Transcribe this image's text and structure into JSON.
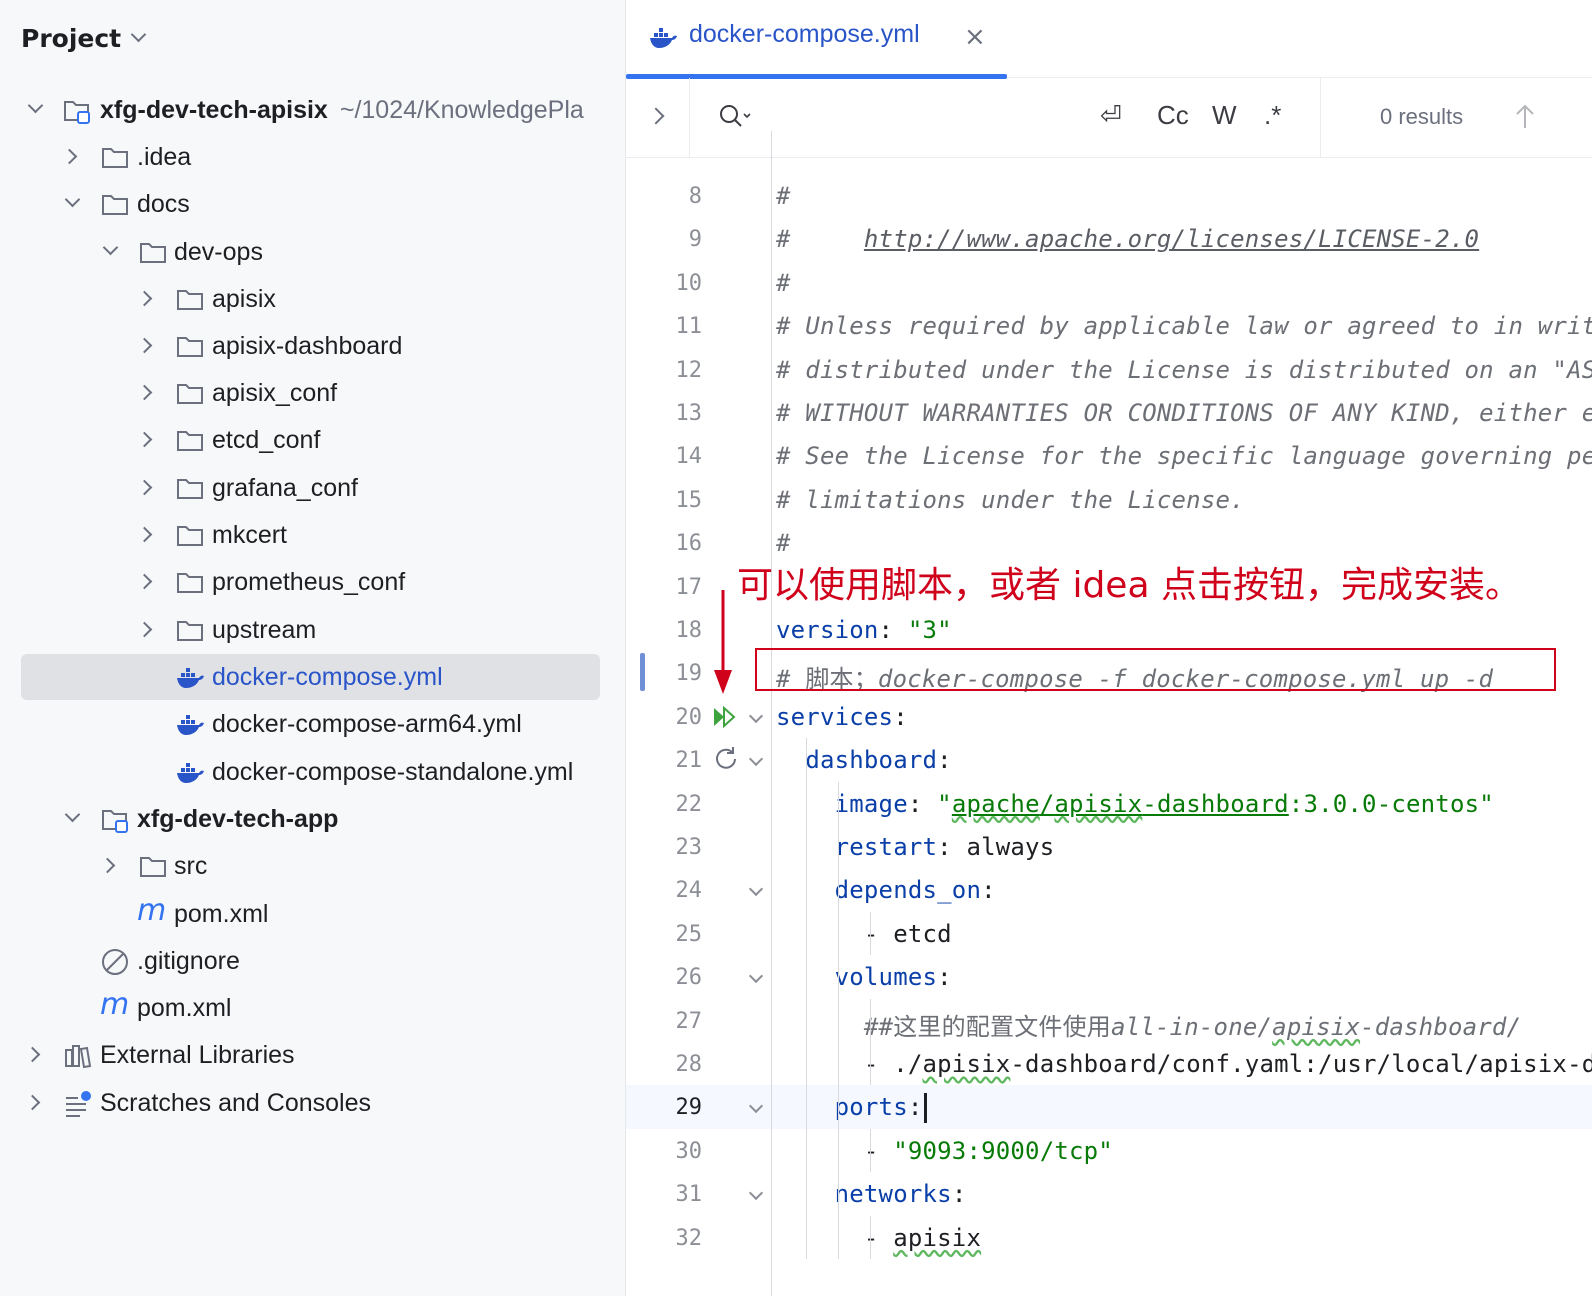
{
  "project_panel": {
    "title": "Project",
    "tree": [
      {
        "label": "xfg-dev-tech-apisix",
        "extra": "~/1024/KnowledgePla",
        "type": "module",
        "bold": true
      },
      {
        "label": ".idea",
        "type": "folder"
      },
      {
        "label": "docs",
        "type": "folder"
      },
      {
        "label": "dev-ops",
        "type": "folder"
      },
      {
        "label": "apisix",
        "type": "folder"
      },
      {
        "label": "apisix-dashboard",
        "type": "folder"
      },
      {
        "label": "apisix_conf",
        "type": "folder"
      },
      {
        "label": "etcd_conf",
        "type": "folder"
      },
      {
        "label": "grafana_conf",
        "type": "folder"
      },
      {
        "label": "mkcert",
        "type": "folder"
      },
      {
        "label": "prometheus_conf",
        "type": "folder"
      },
      {
        "label": "upstream",
        "type": "folder"
      },
      {
        "label": "docker-compose.yml",
        "type": "docker",
        "selected": true
      },
      {
        "label": "docker-compose-arm64.yml",
        "type": "docker"
      },
      {
        "label": "docker-compose-standalone.yml",
        "type": "docker"
      },
      {
        "label": "xfg-dev-tech-app",
        "type": "module",
        "bold": true
      },
      {
        "label": "src",
        "type": "folder"
      },
      {
        "label": "pom.xml",
        "type": "maven"
      },
      {
        "label": ".gitignore",
        "type": "ignore"
      },
      {
        "label": "pom.xml",
        "type": "maven"
      },
      {
        "label": "External Libraries",
        "type": "library"
      },
      {
        "label": "Scratches and Consoles",
        "type": "scratch"
      }
    ]
  },
  "editor": {
    "tab": {
      "label": "docker-compose.yml",
      "close": "×"
    },
    "find": {
      "opt_regex_wrap": "⏎",
      "opt_case": "Cc",
      "opt_word": "W",
      "opt_regex": ".*",
      "results": "0 results"
    },
    "current_line": 29,
    "lines": [
      {
        "n": "8",
        "text": "#"
      },
      {
        "n": "9",
        "text": "#     http://www.apache.org/licenses/LICENSE-2.0"
      },
      {
        "n": "10",
        "text": "#"
      },
      {
        "n": "11",
        "text": "# Unless required by applicable law or agreed to in writing, software"
      },
      {
        "n": "12",
        "text": "# distributed under the License is distributed on an \"AS IS\" BASIS,"
      },
      {
        "n": "13",
        "text": "# WITHOUT WARRANTIES OR CONDITIONS OF ANY KIND, either express or implied."
      },
      {
        "n": "14",
        "text": "# See the License for the specific language governing permissions and"
      },
      {
        "n": "15",
        "text": "# limitations under the License."
      },
      {
        "n": "16",
        "text": "#"
      },
      {
        "n": "17",
        "text": ""
      },
      {
        "n": "18",
        "text": "version: \"3\""
      },
      {
        "n": "19",
        "text": "# 脚本；docker-compose -f docker-compose.yml up -d"
      },
      {
        "n": "20",
        "text": "services:"
      },
      {
        "n": "21",
        "text": "  dashboard:"
      },
      {
        "n": "22",
        "text": "    image: \"apache/apisix-dashboard:3.0.0-centos\""
      },
      {
        "n": "23",
        "text": "    restart: always"
      },
      {
        "n": "24",
        "text": "    depends_on:"
      },
      {
        "n": "25",
        "text": "      - etcd"
      },
      {
        "n": "26",
        "text": "    volumes:"
      },
      {
        "n": "27",
        "text": "      ##这里的配置文件使用all-in-one/apisix-dashboard/"
      },
      {
        "n": "28",
        "text": "      - ./apisix-dashboard/conf.yaml:/usr/local/apisix-dashboard/conf/conf.yaml"
      },
      {
        "n": "29",
        "text": "    ports:"
      },
      {
        "n": "30",
        "text": "      - \"9093:9000/tcp\""
      },
      {
        "n": "31",
        "text": "    networks:"
      },
      {
        "n": "32",
        "text": "      - apisix"
      }
    ]
  },
  "annotation": {
    "text": "可以使用脚本，或者 idea 点击按钮，完成安装。",
    "color": "#d0021b"
  },
  "colors": {
    "accent": "#3574f0",
    "key": "#0a3fa8",
    "string": "#077a07",
    "comment": "#6c6f75"
  }
}
